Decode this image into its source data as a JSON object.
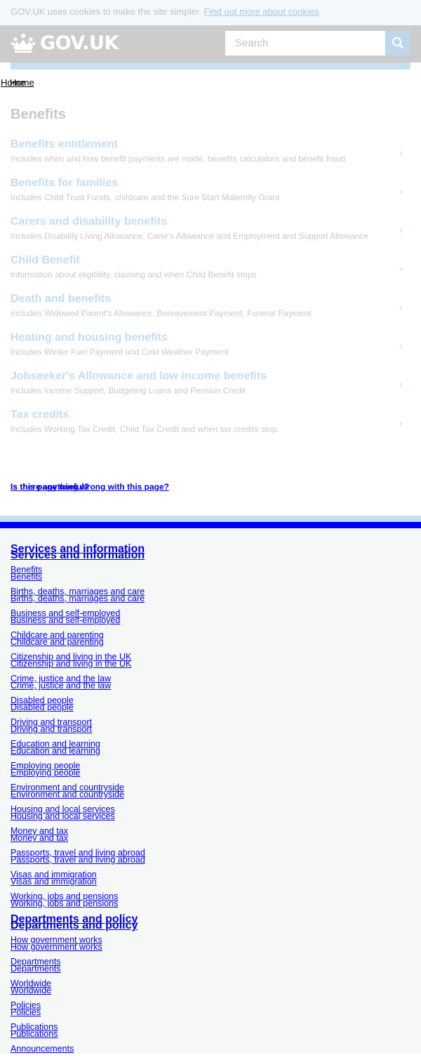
{
  "cookie_banner": {
    "text": "GOV.UK uses cookies to make the site simpler.",
    "link": "Find out more about cookies"
  },
  "header": {
    "logo_text": "GOV.UK",
    "logo_icon": "crown-icon",
    "search_placeholder": "Search",
    "search_icon": "search-icon"
  },
  "breadcrumb": {
    "items": [
      "Home",
      "Home"
    ]
  },
  "page": {
    "title": "Benefits",
    "topics": [
      {
        "title": "Benefits entitlement",
        "description": "Includes when and how benefit payments are made, benefits calculators and benefit fraud"
      },
      {
        "title": "Benefits for families",
        "description": "Includes Child Trust Funds, childcare and the Sure Start Maternity Grant"
      },
      {
        "title": "Carers and disability benefits",
        "description": "Includes Disability Living Allowance, Carer's Allowance and Employment and Support Allowance"
      },
      {
        "title": "Child Benefit",
        "description": "Information about eligibility, claiming and when Child Benefit stops"
      },
      {
        "title": "Death and benefits",
        "description": "Includes Widowed Parent's Allowance, Bereavement Payment, Funeral Payment"
      },
      {
        "title": "Heating and housing benefits",
        "description": "Includes Winter Fuel Payment and Cold Weather Payment"
      },
      {
        "title": "Jobseeker's Allowance and low income benefits",
        "description": "Includes Income Support, Budgeting Loans and Pension Credit"
      },
      {
        "title": "Tax credits",
        "description": "Includes Working Tax Credit, Child Tax Credit and when tax credits stop"
      }
    ],
    "chevron": "›"
  },
  "feedback": {
    "line1": "Is this page useful?",
    "line2": "Is there anything wrong with this page?"
  },
  "footer": {
    "services_heading": "Services and information",
    "services": [
      "Benefits",
      "Births, deaths, marriages and care",
      "Business and self-employed",
      "Childcare and parenting",
      "Citizenship and living in the UK",
      "Crime, justice and the law",
      "Disabled people",
      "Driving and transport",
      "Education and learning",
      "Employing people",
      "Environment and countryside",
      "Housing and local services",
      "Money and tax",
      "Passports, travel and living abroad",
      "Visas and immigration",
      "Working, jobs and pensions"
    ],
    "departments_heading": "Departments and policy",
    "departments": [
      "How government works",
      "Departments",
      "Worldwide",
      "Policies",
      "Publications",
      "Announcements"
    ]
  },
  "colors": {
    "header_bg": "#cccccc",
    "footer_blue": "#0000ff",
    "link": "#0000ee",
    "faded_link": "#c4dcf0"
  }
}
